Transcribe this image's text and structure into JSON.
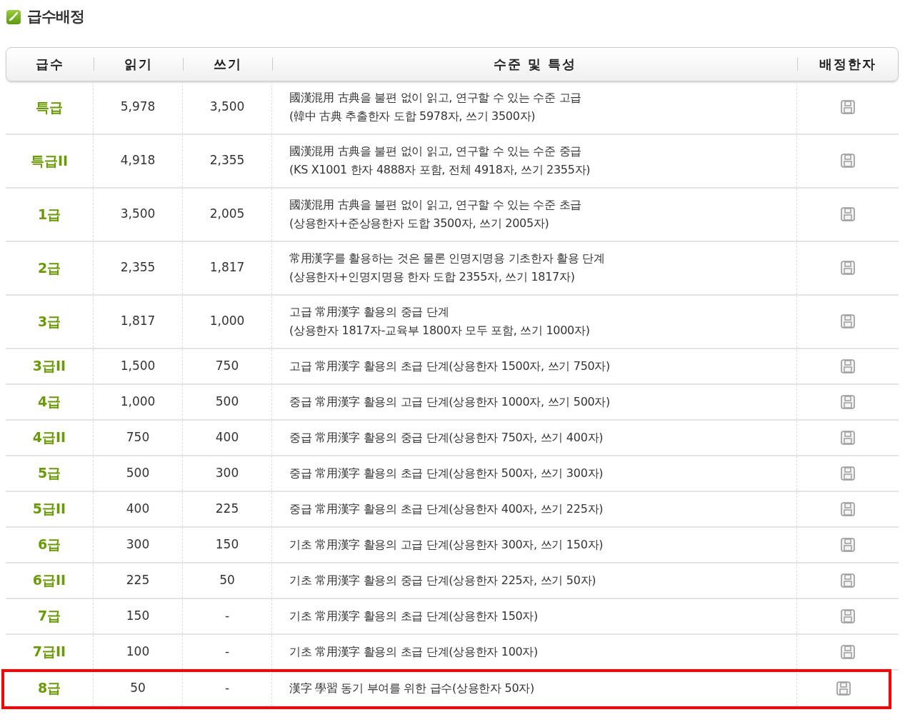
{
  "title": "급수배정",
  "table": {
    "columns": [
      "급수",
      "읽기",
      "쓰기",
      "수준 및 특성",
      "배정한자"
    ],
    "rows": [
      {
        "grade": "특급",
        "reading": "5,978",
        "writing": "3,500",
        "description": [
          "國漢混用 古典을 불편 없이 읽고, 연구할 수 있는 수준 고급",
          "(韓中 古典 추출한자 도합 5978자, 쓰기 3500자)"
        ],
        "highlighted": false
      },
      {
        "grade": "특급II",
        "reading": "4,918",
        "writing": "2,355",
        "description": [
          "國漢混用 古典을 불편 없이 읽고, 연구할 수 있는 수준 중급",
          "(KS X1001 한자 4888자 포함, 전체 4918자, 쓰기 2355자)"
        ],
        "highlighted": false
      },
      {
        "grade": "1급",
        "reading": "3,500",
        "writing": "2,005",
        "description": [
          "國漢混用 古典을 불편 없이 읽고, 연구할 수 있는 수준 초급",
          "(상용한자+준상용한자 도합 3500자, 쓰기 2005자)"
        ],
        "highlighted": false
      },
      {
        "grade": "2급",
        "reading": "2,355",
        "writing": "1,817",
        "description": [
          "常用漢字를 활용하는 것은 물론 인명지명용 기초한자 활용 단계",
          "(상용한자+인명지명용 한자 도합 2355자, 쓰기 1817자)"
        ],
        "highlighted": false
      },
      {
        "grade": "3급",
        "reading": "1,817",
        "writing": "1,000",
        "description": [
          "고급 常用漢字 활용의 중급 단계",
          "(상용한자 1817자-교육부 1800자 모두 포함, 쓰기 1000자)"
        ],
        "highlighted": false
      },
      {
        "grade": "3급II",
        "reading": "1,500",
        "writing": "750",
        "description": [
          "고급 常用漢字 활용의 초급 단계(상용한자 1500자, 쓰기 750자)"
        ],
        "highlighted": false
      },
      {
        "grade": "4급",
        "reading": "1,000",
        "writing": "500",
        "description": [
          "중급 常用漢字 활용의 고급 단계(상용한자 1000자, 쓰기 500자)"
        ],
        "highlighted": false
      },
      {
        "grade": "4급II",
        "reading": "750",
        "writing": "400",
        "description": [
          "중급 常用漢字 활용의 중급 단계(상용한자 750자, 쓰기 400자)"
        ],
        "highlighted": false
      },
      {
        "grade": "5급",
        "reading": "500",
        "writing": "300",
        "description": [
          "중급 常用漢字 활용의 초급 단계(상용한자 500자, 쓰기 300자)"
        ],
        "highlighted": false
      },
      {
        "grade": "5급II",
        "reading": "400",
        "writing": "225",
        "description": [
          "중급 常用漢字 활용의 초급 단계(상용한자 400자, 쓰기 225자)"
        ],
        "highlighted": false
      },
      {
        "grade": "6급",
        "reading": "300",
        "writing": "150",
        "description": [
          "기초 常用漢字 활용의 고급 단계(상용한자 300자, 쓰기 150자)"
        ],
        "highlighted": false
      },
      {
        "grade": "6급II",
        "reading": "225",
        "writing": "50",
        "description": [
          "기초 常用漢字 활용의 중급 단계(상용한자 225자, 쓰기 50자)"
        ],
        "highlighted": false
      },
      {
        "grade": "7급",
        "reading": "150",
        "writing": "-",
        "description": [
          "기초 常用漢字 활용의 초급 단계(상용한자 150자)"
        ],
        "highlighted": false
      },
      {
        "grade": "7급II",
        "reading": "100",
        "writing": "-",
        "description": [
          "기초 常用漢字 활용의 초급 단계(상용한자 100자)"
        ],
        "highlighted": false
      },
      {
        "grade": "8급",
        "reading": "50",
        "writing": "-",
        "description": [
          "漢字 學習 동기 부여를 위한 급수(상용한자 50자)"
        ],
        "highlighted": true
      }
    ]
  }
}
